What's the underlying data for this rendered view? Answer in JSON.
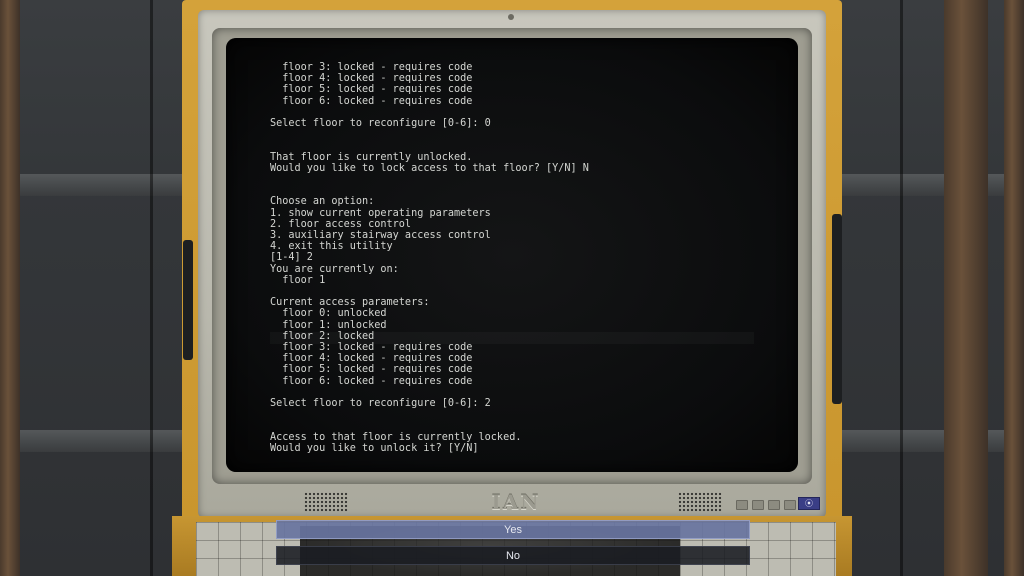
{
  "monitor": {
    "brand": "IAN",
    "power_symbol": "⦿"
  },
  "terminal": {
    "lines": [
      "  floor 3: locked - requires code",
      "  floor 4: locked - requires code",
      "  floor 5: locked - requires code",
      "  floor 6: locked - requires code",
      "",
      "Select floor to reconfigure [0-6]: 0",
      "",
      "",
      "That floor is currently unlocked.",
      "Would you like to lock access to that floor? [Y/N] N",
      "",
      "",
      "Choose an option:",
      "1. show current operating parameters",
      "2. floor access control",
      "3. auxiliary stairway access control",
      "4. exit this utility",
      "[1-4] 2",
      "You are currently on:",
      "  floor 1",
      "",
      "Current access parameters:",
      "  floor 0: unlocked",
      "  floor 1: unlocked",
      "  floor 2: locked",
      "  floor 3: locked - requires code",
      "  floor 4: locked - requires code",
      "  floor 5: locked - requires code",
      "  floor 6: locked - requires code",
      "",
      "Select floor to reconfigure [0-6]: 2",
      "",
      "",
      "Access to that floor is currently locked.",
      "Would you like to unlock it? [Y/N]"
    ]
  },
  "dialog": {
    "options": [
      {
        "label": "Yes",
        "selected": true
      },
      {
        "label": "No",
        "selected": false
      }
    ]
  }
}
